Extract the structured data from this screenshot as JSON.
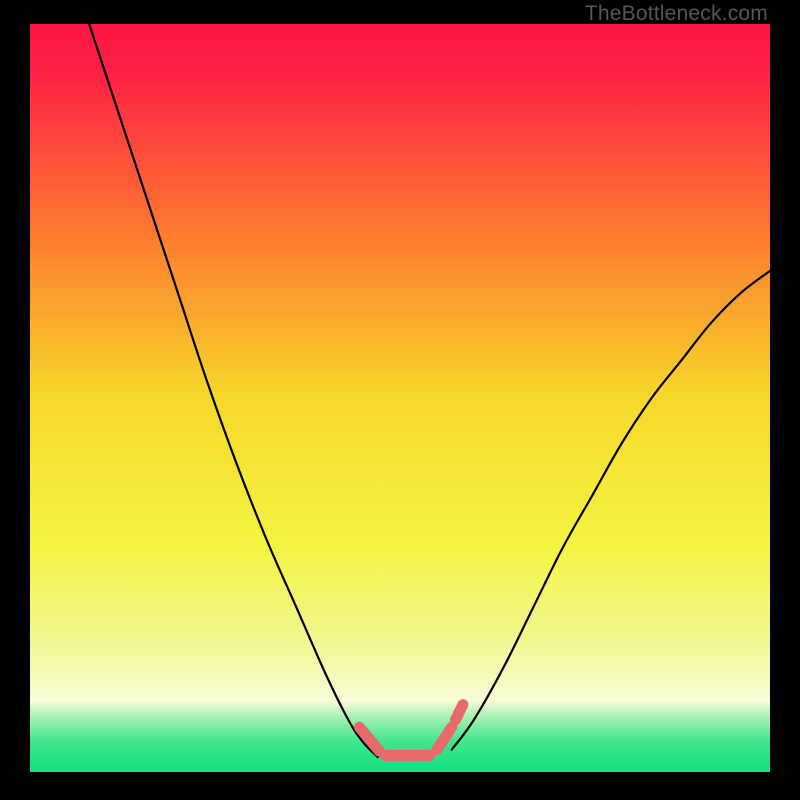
{
  "watermark": "TheBottleneck.com",
  "chart_data": {
    "type": "line",
    "title": "",
    "xlabel": "",
    "ylabel": "",
    "xlim": [
      0,
      100
    ],
    "ylim": [
      0,
      100
    ],
    "grid": false,
    "legend": false,
    "gradient_stops": [
      {
        "offset": 0.0,
        "color": "#ff1744"
      },
      {
        "offset": 0.06,
        "color": "#ff1f46"
      },
      {
        "offset": 0.28,
        "color": "#fd7a2f"
      },
      {
        "offset": 0.5,
        "color": "#f7d82a"
      },
      {
        "offset": 0.7,
        "color": "#f4f443"
      },
      {
        "offset": 0.82,
        "color": "#f2f78e"
      },
      {
        "offset": 0.905,
        "color": "#f8fbd6"
      },
      {
        "offset": 0.93,
        "color": "#9af0b0"
      },
      {
        "offset": 0.96,
        "color": "#3fe58c"
      },
      {
        "offset": 1.0,
        "color": "#13df81"
      }
    ],
    "series": [
      {
        "name": "curve-left",
        "stroke": "#000000",
        "x": [
          8,
          12,
          16,
          20,
          24,
          28,
          32,
          36,
          40,
          43,
          45,
          47
        ],
        "y": [
          100,
          88,
          76,
          64,
          52,
          41,
          31,
          22,
          13,
          7,
          4,
          2
        ]
      },
      {
        "name": "curve-right",
        "stroke": "#000000",
        "x": [
          57,
          60,
          64,
          68,
          72,
          76,
          80,
          84,
          88,
          92,
          96,
          100
        ],
        "y": [
          3,
          7,
          14,
          22,
          30,
          37,
          44,
          50,
          55,
          60,
          64,
          67
        ]
      },
      {
        "name": "marker-band",
        "stroke": "#e76a6a",
        "type": "segments",
        "segments": [
          {
            "x": [
              44.5,
              47.2
            ],
            "y": [
              6.0,
              2.8
            ]
          },
          {
            "x": [
              48.0,
              54.0
            ],
            "y": [
              2.2,
              2.2
            ]
          },
          {
            "x": [
              55.0,
              57.0
            ],
            "y": [
              3.0,
              6.0
            ]
          },
          {
            "x": [
              57.5,
              58.5
            ],
            "y": [
              7.0,
              9.0
            ]
          }
        ]
      }
    ]
  }
}
